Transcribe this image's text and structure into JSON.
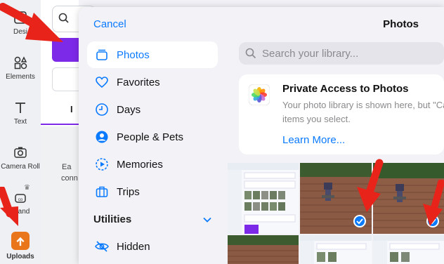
{
  "background_app": {
    "rail": [
      {
        "label": "Desi",
        "icon": "design-icon"
      },
      {
        "label": "Elements",
        "icon": "elements-icon"
      },
      {
        "label": "Text",
        "icon": "text-icon"
      },
      {
        "label": "Camera Roll",
        "icon": "camera-icon"
      },
      {
        "label": "Brand",
        "icon": "brand-icon"
      },
      {
        "label": "Uploads",
        "icon": "upload-icon"
      }
    ],
    "tab_label": "I",
    "body_text_line1": "Ea",
    "body_text_line2": "conn"
  },
  "sheet": {
    "cancel_label": "Cancel",
    "title": "Photos",
    "nav": [
      {
        "label": "Photos",
        "icon": "photos-icon",
        "selected": true
      },
      {
        "label": "Favorites",
        "icon": "heart-icon",
        "selected": false
      },
      {
        "label": "Days",
        "icon": "clock-icon",
        "selected": false
      },
      {
        "label": "People & Pets",
        "icon": "person-circle-icon",
        "selected": false
      },
      {
        "label": "Memories",
        "icon": "memories-icon",
        "selected": false
      },
      {
        "label": "Trips",
        "icon": "suitcase-icon",
        "selected": false
      }
    ],
    "section_label": "Utilities",
    "utility_items": [
      {
        "label": "Hidden",
        "icon": "eye-slash-icon"
      }
    ],
    "search_placeholder": "Search your library...",
    "private_access": {
      "title": "Private Access to Photos",
      "body_line1": "Your photo library is shown here, but \"Ca",
      "body_line2": "items you select.",
      "link": "Learn More..."
    },
    "accent_color": "#0a7aff"
  }
}
